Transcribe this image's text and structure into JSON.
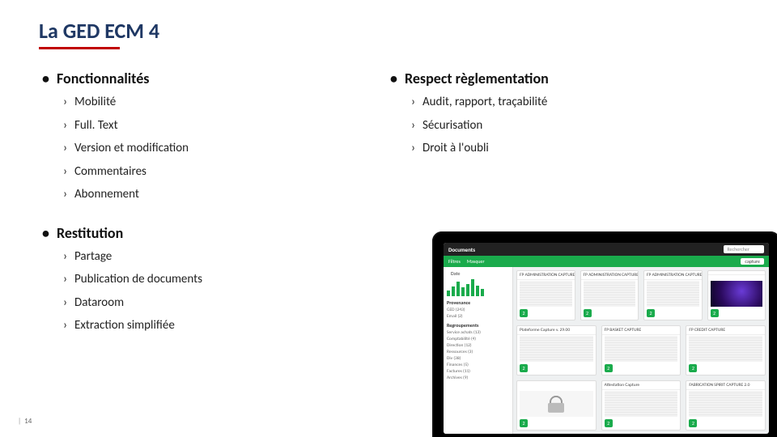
{
  "title": "La GED ECM 4",
  "sections": {
    "fonctionnalites": {
      "heading": "Fonctionnalités",
      "items": [
        "Mobilité",
        "Full. Text",
        "Version et modification",
        "Commentaires",
        "Abonnement"
      ]
    },
    "restitution": {
      "heading": "Restitution",
      "items": [
        "Partage",
        "Publication de documents",
        "Dataroom",
        "Extraction simplifiée"
      ]
    },
    "reglementation": {
      "heading": "Respect règlementation",
      "items": [
        "Audit, rapport, traçabilité",
        "Sécurisation",
        "Droit à l'oubli"
      ]
    }
  },
  "page_number": "14",
  "laptop": {
    "topbar": {
      "title": "Documents",
      "search_placeholder": "Rechercher"
    },
    "subbar": {
      "filtres": "Filtres",
      "masquer": "Masquer",
      "date": "Date",
      "recent_pill": "capture"
    },
    "sidebar": {
      "provenance_label": "Provenance",
      "provenance": [
        "GED (243)",
        "Email (2)"
      ],
      "regroupements_label": "Regroupements",
      "regroupements": [
        "Service achats (13)",
        "Comptabilité (4)",
        "Direction (12)",
        "Ressources (3)",
        "Div (38)",
        "Finances (5)",
        "Factures (11)",
        "Archives (9)"
      ]
    },
    "cards_row1": [
      {
        "title": "FP ADMINISTRATION CAPTURE",
        "badge": "2"
      },
      {
        "title": "FP ADMINISTRATION CAPTURE",
        "badge": "2"
      },
      {
        "title": "FP ADMINISTRATION CAPTURE",
        "badge": "2"
      },
      {
        "title": "",
        "badge": "2",
        "swirl": true
      }
    ],
    "cards_row2": [
      {
        "title": "Plateforme Capture v. 29.00",
        "badge": "2"
      },
      {
        "title": "FP BASKET CAPTURE",
        "badge": "2"
      },
      {
        "title": "FP CREDIT CAPTURE",
        "badge": "2"
      }
    ],
    "cards_row3": [
      {
        "title": "",
        "badge": "2",
        "lock": true
      },
      {
        "title": "Attestation Capture",
        "badge": "2"
      },
      {
        "title": "FABRICATION SPIRIT CAPTURE 2.0",
        "badge": "2"
      }
    ]
  }
}
